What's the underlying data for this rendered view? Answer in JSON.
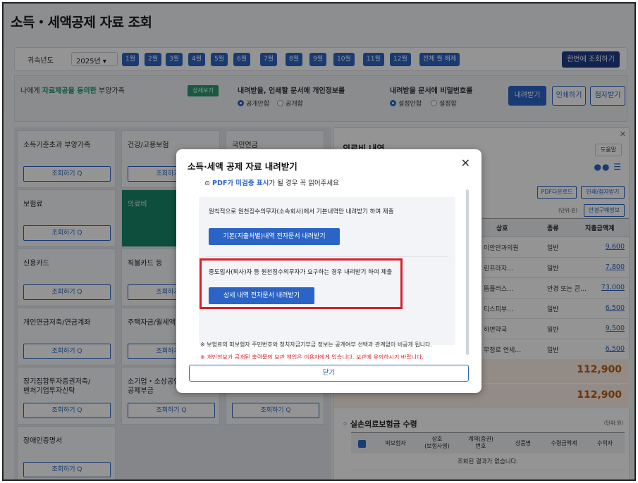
{
  "page": {
    "title": "소득・세액공제 자료 조회"
  },
  "months_bar": {
    "year_label": "귀속년도",
    "year_value": "2025년 ▾",
    "months": [
      "1월",
      "2월",
      "3월",
      "4월",
      "5월",
      "6월",
      "7월",
      "8월",
      "9월",
      "10월",
      "11월",
      "12월",
      "전체 월 해제"
    ],
    "bulk_label": "한번에 조회하기"
  },
  "consent": {
    "prefix": "나에게 ",
    "highlight": "자료제공을 동의한",
    "suffix": " 부양가족",
    "detail_btn": "상세보기",
    "option1_title": "내려받을, 인쇄할 문서에 개인정보를",
    "option1_a": "공개안함",
    "option1_b": "공개함",
    "option2_title": "내려받을 문서에 비밀번호를",
    "option2_a": "설정안함",
    "option2_b": "설정함",
    "download_btn": "내려받기",
    "print_btn": "인쇄하기",
    "braille_btn": "점자받기"
  },
  "grid": {
    "query_label": "조회하기 Q",
    "cells": [
      {
        "label": "소득기준초과 부양가족"
      },
      {
        "label": "건강/고용보험"
      },
      {
        "label": "국민연금"
      },
      {
        "label": "보험료"
      },
      {
        "label": "의료비"
      },
      {
        "label": "신용카드"
      },
      {
        "label": "직불카드 등"
      },
      {
        "label": "개인연금저축/연금계좌"
      },
      {
        "label": "주택자금/월세액"
      },
      {
        "label": "장기집합투자증권저축/\n벤처기업투자신탁"
      },
      {
        "label": "소기업・소상공인\n공제부금"
      },
      {
        "label": "장애인증명서"
      }
    ]
  },
  "medical": {
    "title": "의료비 내역",
    "help_btn": "도움말",
    "pdf_btn": "PDF다운로드",
    "print_braille_btn": "인쇄/점자받기",
    "unit": "(단위:원)",
    "info_btn": "안경구매정보",
    "headers": [
      "상호",
      "종류",
      "지출금액계"
    ],
    "rows": [
      {
        "name": "이안안과의원",
        "type": "일반",
        "amount": "9,600"
      },
      {
        "name": "린프라자…",
        "type": "일반",
        "amount": "7,800"
      },
      {
        "name": "뜸플러스…",
        "type": "안경 또는 콘…",
        "amount": "73,000"
      },
      {
        "name": "티스피부…",
        "type": "일반",
        "amount": "6,500"
      },
      {
        "name": "하면약국",
        "type": "일반",
        "amount": "9,500"
      },
      {
        "name": "무정로 연세…",
        "type": "일반",
        "amount": "6,500"
      }
    ],
    "total1": "112,900",
    "total2": "112,900"
  },
  "insurance": {
    "title": "실손의료보험금 수령",
    "unit": "(단위:원)",
    "headers": [
      "피보험자",
      "상호\n(보험사명)",
      "계약(증권)\n번호",
      "상품명",
      "수령금액계",
      "수익자"
    ],
    "empty": "조회된 결과가 없습니다."
  },
  "modal": {
    "title": "소득·세액 공제 자료 내려받기",
    "close": "✕",
    "pdf_note_blue": "PDF가 미검증 표시",
    "pdf_note_rest": "가 될 경우 꼭 읽어주세요",
    "desc1": "원칙적으로 원천징수의무자(소속회사)에서 기본내역만 내려받기 하여 제출",
    "btn1": "기본(지출처별)내역 전자문서 내려받기",
    "desc2": "중도입사(퇴사)자 등 원천징수의무자가 요구하는 경우 내려받기 하여 제출",
    "btn2": "상세 내역 전자문서 내려받기",
    "warn1": "※ 개인정보가 공개된 출력물의 보관 책임은 이용자에게 있습니다. 보관에 유의하시기 바랍니다.",
    "warn2": "※ 보험료의 피보험자 주민번호와 청치자금기부금 정보는 공개여부 선택과 관계없이 비공개 됩니다.",
    "close_btn": "닫기"
  }
}
